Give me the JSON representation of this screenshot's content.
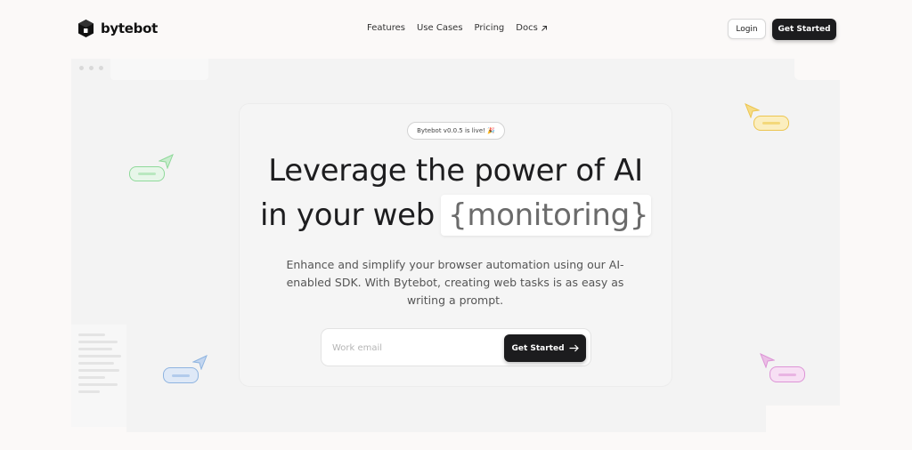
{
  "brand": {
    "name": "bytebot"
  },
  "nav": {
    "items": [
      {
        "label": "Features"
      },
      {
        "label": "Use Cases"
      },
      {
        "label": "Pricing"
      },
      {
        "label": "Docs",
        "icon": "external-arrow-icon"
      }
    ]
  },
  "header": {
    "login_label": "Login",
    "get_started_label": "Get Started"
  },
  "hero": {
    "badge": "Bytebot v0.0.5 is live! 🎉",
    "headline_line1": "Leverage the power of AI",
    "headline_line2_prefix": "in your web",
    "typed_word": "{monitoring}",
    "cursor": "|",
    "subtext": "Enhance and simplify your browser automation using our AI-enabled SDK. With Bytebot, creating web tasks is as easy as writing a prompt.",
    "email_placeholder": "Work email",
    "email_value": "",
    "cta_label": "Get Started",
    "cta_icon": "arrow-right-icon"
  },
  "decor": {
    "colors": {
      "green": "#8fd99a",
      "yellow": "#ecc54f",
      "blue": "#8fb4e0",
      "pink": "#dd94d6"
    }
  }
}
